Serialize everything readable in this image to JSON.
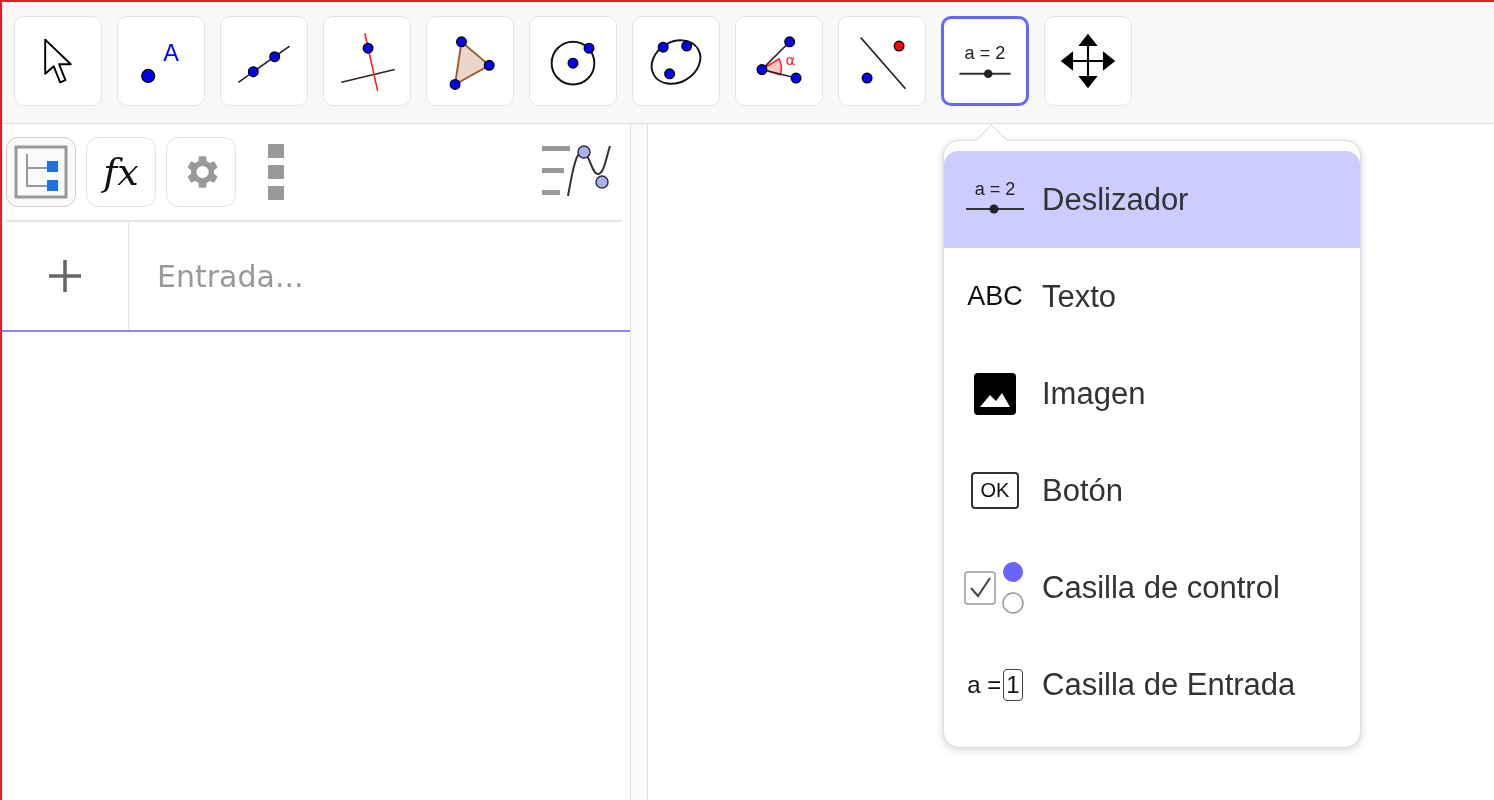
{
  "toolbar": {
    "tools": [
      {
        "kind": "move",
        "selected": false
      },
      {
        "kind": "point",
        "label": "A",
        "selected": false
      },
      {
        "kind": "line",
        "selected": false
      },
      {
        "kind": "perpendicular",
        "selected": false
      },
      {
        "kind": "polygon",
        "selected": false
      },
      {
        "kind": "circle",
        "selected": false
      },
      {
        "kind": "conic",
        "selected": false
      },
      {
        "kind": "angle",
        "label": "α",
        "selected": false
      },
      {
        "kind": "reflect",
        "selected": false
      },
      {
        "kind": "slider",
        "label": "a = 2",
        "selected": true
      },
      {
        "kind": "move_view",
        "selected": false
      }
    ]
  },
  "algebra": {
    "header": [
      {
        "kind": "tree",
        "selected": true
      },
      {
        "kind": "fx",
        "label": "fx",
        "selected": false
      },
      {
        "kind": "settings",
        "selected": false
      },
      {
        "kind": "more"
      },
      {
        "kind": "graph"
      }
    ],
    "input": {
      "placeholder": "Entrada..."
    }
  },
  "menu": {
    "items": [
      {
        "kind": "slider",
        "icon_text": "a = 2",
        "label": "Deslizador",
        "selected": true
      },
      {
        "kind": "text",
        "icon_text": "ABC",
        "label": "Texto",
        "selected": false
      },
      {
        "kind": "image",
        "label": "Imagen",
        "selected": false
      },
      {
        "kind": "button",
        "icon_text": "OK",
        "label": "Botón",
        "selected": false
      },
      {
        "kind": "checkbox",
        "label": "Casilla de control",
        "selected": false
      },
      {
        "kind": "input",
        "icon_text": "a =",
        "icon_box": "1",
        "label": "Casilla de Entrada",
        "selected": false
      }
    ]
  }
}
